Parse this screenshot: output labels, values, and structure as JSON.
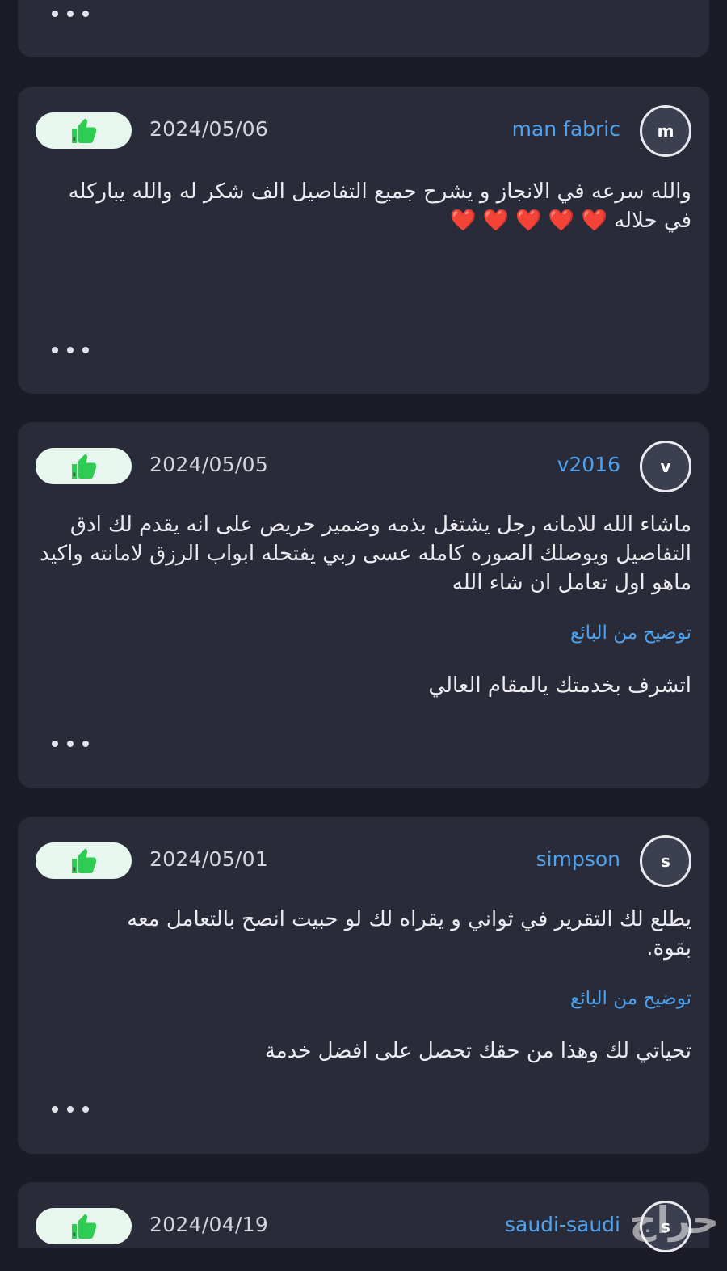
{
  "colors": {
    "background": "#1c1c26",
    "card": "#2a2b39",
    "accent_blue": "#4fa3ee",
    "like_pill": "#e7f7ee",
    "like_icon": "#2ecc52"
  },
  "icons": {
    "like": "thumbs-up-icon",
    "more": "more-dots-icon"
  },
  "reviews": [
    {
      "avatar_letter": "m",
      "username": "man fabric",
      "date": "2024/05/06",
      "text": "والله سرعه في الانجاز و يشرح جميع التفاصيل الف شكر له والله يباركله في حلاله",
      "hearts": "❤️ ❤️ ❤️ ❤️ ❤️"
    },
    {
      "avatar_letter": "v",
      "username": "v2016",
      "date": "2024/05/05",
      "text": "ماشاء الله للامانه رجل يشتغل بذمه وضمير حريص على انه يقدم لك ادق التفاصيل ويوصلك الصوره كامله عسى ربي يفتحله ابواب الرزق لامانته واكيد ماهو اول تعامل ان شاء الله",
      "reply_label": "توضيح من البائع",
      "reply_text": "اتشرف بخدمتك يالمقام العالي"
    },
    {
      "avatar_letter": "s",
      "username": "simpson",
      "date": "2024/05/01",
      "text": "يطلع لك التقرير في ثواني و يقراه لك لو حبيت انصح بالتعامل معه بقوة.",
      "reply_label": "توضيح من البائع",
      "reply_text": "تحياتي لك وهذا من حقك تحصل على افضل خدمة"
    },
    {
      "avatar_letter": "s",
      "username": "saudi-saudi",
      "date": "2024/04/19"
    }
  ],
  "watermark": "حراج"
}
